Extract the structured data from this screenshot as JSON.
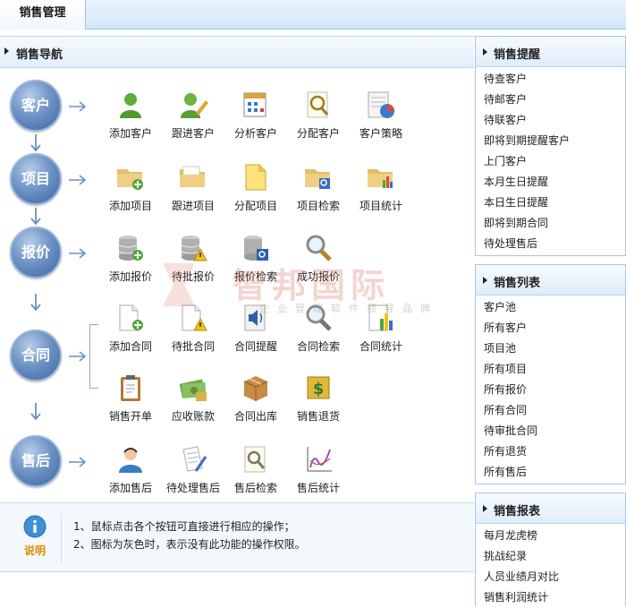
{
  "top_tab": "销售管理",
  "main": {
    "title": "销售导航",
    "stages": [
      {
        "label": "客户",
        "items": [
          "添加客户",
          "跟进客户",
          "分析客户",
          "分配客户",
          "客户策略"
        ]
      },
      {
        "label": "项目",
        "items": [
          "添加项目",
          "跟进项目",
          "分配项目",
          "项目检索",
          "项目统计"
        ]
      },
      {
        "label": "报价",
        "items": [
          "添加报价",
          "待批报价",
          "报价检索",
          "成功报价"
        ]
      },
      {
        "label": "合同",
        "items": [
          "添加合同",
          "待批合同",
          "合同提醒",
          "合同检索",
          "合同统计",
          "销售开单",
          "应收账款",
          "合同出库",
          "销售退货"
        ]
      },
      {
        "label": "售后",
        "items": [
          "添加售后",
          "待处理售后",
          "售后检索",
          "售后统计"
        ]
      }
    ]
  },
  "watermark": {
    "title": "智邦国际",
    "subtitle": "企业管理软件领导品牌"
  },
  "note": {
    "label": "说明",
    "lines": [
      "1、鼠标点击各个按钮可直接进行相应的操作；",
      "2、图标为灰色时，表示没有此功能的操作权限。"
    ]
  },
  "right": {
    "reminders": {
      "title": "销售提醒",
      "items": [
        "待查客户",
        "待邮客户",
        "待联客户",
        "即将到期提醒客户",
        "上门客户",
        "本月生日提醒",
        "本日生日提醒",
        "即将到期合同",
        "待处理售后"
      ]
    },
    "lists": {
      "title": "销售列表",
      "items": [
        "客户池",
        "所有客户",
        "项目池",
        "所有项目",
        "所有报价",
        "所有合同",
        "待审批合同",
        "所有退货",
        "所有售后"
      ]
    },
    "reports": {
      "title": "销售报表",
      "items": [
        "每月龙虎榜",
        "挑战纪录",
        "人员业绩月对比",
        "销售利润统计"
      ]
    }
  },
  "colors": {
    "header_bg": "#dfedfa",
    "circle": "#4a72ad",
    "note_label": "#e08a00",
    "border": "#a9c6e6"
  }
}
